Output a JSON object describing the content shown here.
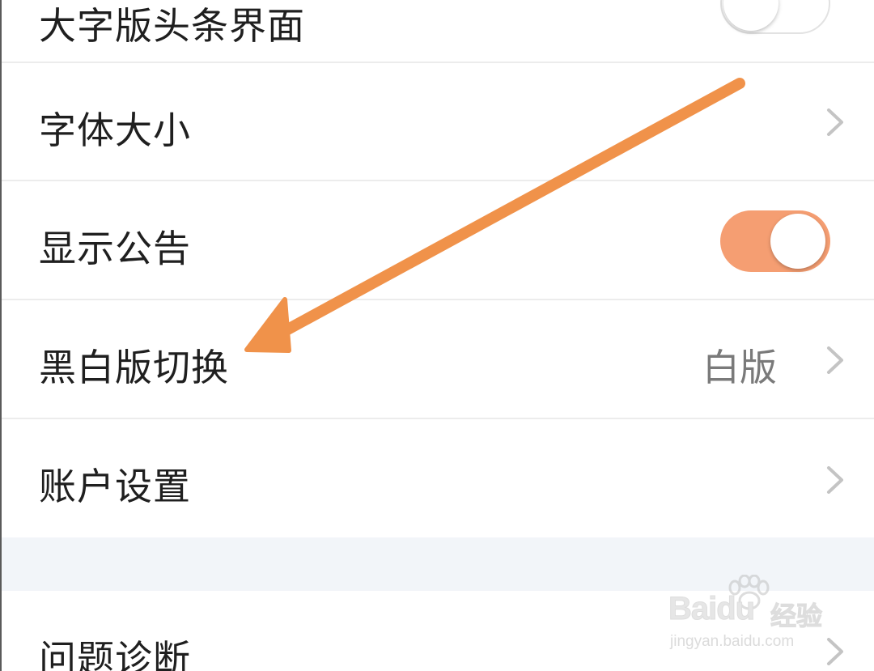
{
  "settings": {
    "items": [
      {
        "label": "大字版头条界面",
        "control": "toggle",
        "toggle_state": "off"
      },
      {
        "label": "字体大小",
        "control": "chevron"
      },
      {
        "label": "显示公告",
        "control": "toggle",
        "toggle_state": "on"
      },
      {
        "label": "黑白版切换",
        "control": "chevron",
        "value": "白版"
      },
      {
        "label": "账户设置",
        "control": "chevron"
      },
      {
        "label": "问题诊断",
        "control": "chevron"
      }
    ]
  },
  "annotation": {
    "arrow_color": "#f0924a",
    "points_to": "黑白版切换"
  },
  "watermark": {
    "logo": "Bai",
    "logo_suffix": "du",
    "product": "经验",
    "url": "jingyan.baidu.com"
  },
  "colors": {
    "toggle_on": "#f59e72",
    "toggle_off_border": "#e2e2e2",
    "chevron": "#c4c4c4",
    "section_gap": "#f2f5f9"
  },
  "icons": {
    "chevron": "chevron-right-icon",
    "watermark_paw": "paw-icon"
  }
}
